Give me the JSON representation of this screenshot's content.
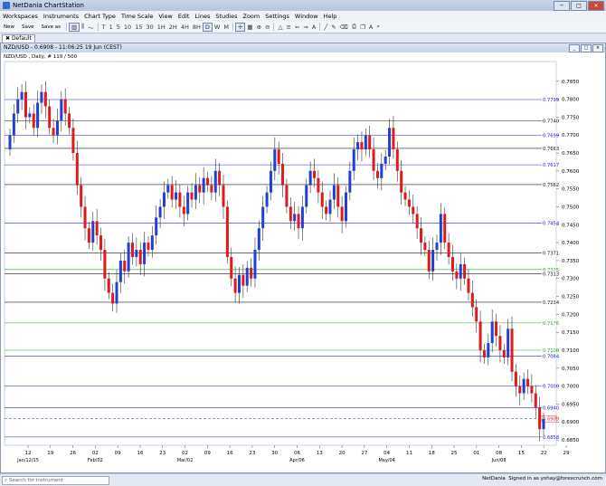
{
  "window": {
    "title": "NetDania ChartStation"
  },
  "menu": [
    "Workspaces",
    "Instruments",
    "Chart Type",
    "Time Scale",
    "View",
    "Edit",
    "Lines",
    "Studies",
    "Zoom",
    "Settings",
    "Window",
    "Help"
  ],
  "toolbar": {
    "file_buttons": [
      "New",
      "Save",
      "Save as"
    ],
    "timescales": [
      "T",
      "1",
      "5",
      "10",
      "15",
      "30",
      "1H",
      "2H",
      "4H",
      "8H",
      "D",
      "W",
      "M"
    ]
  },
  "workspace_tab": {
    "label": "Default"
  },
  "chart": {
    "header_title": "NZD/USD - 0.6908 - 11:06:25 19 Jun (CEST)",
    "subtitle": "NZD/USD , Daily, # 119 / 500",
    "current_price_label": "0.6909"
  },
  "statusbar": {
    "search_placeholder": "Search for instrument",
    "brand": "NetDania",
    "signin": "Signed in as yohay@forexcrunch.com"
  },
  "colors": {
    "up": "#1f3fd6",
    "down": "#e01919",
    "hline": "#1a1a1a",
    "hline_blue": "#2020d0",
    "hline_green": "#22aa22",
    "price": "#6060c0"
  },
  "chart_data": {
    "type": "candlestick",
    "y_ticks": [
      "0.7850",
      "0.7800",
      "0.7750",
      "0.7700",
      "0.7650",
      "0.7600",
      "0.7550",
      "0.7500",
      "0.7450",
      "0.7400",
      "0.7350",
      "0.7300",
      "0.7250",
      "0.7200",
      "0.7150",
      "0.7100",
      "0.7050",
      "0.7000",
      "0.6950",
      "0.6900",
      "0.6850"
    ],
    "ylim": [
      0.6835,
      0.7905
    ],
    "x_ticks": [
      "12",
      "19",
      "26",
      "02",
      "09",
      "16",
      "23",
      "02",
      "09",
      "16",
      "23",
      "30",
      "06",
      "13",
      "20",
      "27",
      "04",
      "11",
      "18",
      "25",
      "01",
      "08",
      "15",
      "22",
      "29"
    ],
    "x_month_labels": [
      {
        "text": "Jan/12/15",
        "at": "12"
      },
      {
        "text": "Feb/02",
        "at": "02"
      },
      {
        "text": "Mar/02",
        "at": "02"
      },
      {
        "text": "Apr/06",
        "at": "06"
      },
      {
        "text": "May/04",
        "at": "04"
      },
      {
        "text": "Jun/08",
        "at": "08"
      }
    ],
    "hlines": [
      {
        "label": "0.7799",
        "value": 0.7799,
        "color": "blue"
      },
      {
        "label": "0.7740",
        "value": 0.774,
        "color": "black"
      },
      {
        "label": "0.7699",
        "value": 0.7699,
        "color": "blue"
      },
      {
        "label": "0.7663",
        "value": 0.7663,
        "color": "black"
      },
      {
        "label": "0.7617",
        "value": 0.7617,
        "color": "blue"
      },
      {
        "label": "0.7562",
        "value": 0.7562,
        "color": "black"
      },
      {
        "label": "0.7454",
        "value": 0.7454,
        "color": "blue"
      },
      {
        "label": "0.7371",
        "value": 0.7371,
        "color": "black"
      },
      {
        "label": "0.7325",
        "value": 0.7325,
        "color": "green"
      },
      {
        "label": "0.7313",
        "value": 0.7313,
        "color": "black"
      },
      {
        "label": "0.7234",
        "value": 0.7234,
        "color": "black"
      },
      {
        "label": "0.7176",
        "value": 0.7176,
        "color": "green"
      },
      {
        "label": "0.7100",
        "value": 0.71,
        "color": "green"
      },
      {
        "label": "0.7084",
        "value": 0.7084,
        "color": "blue"
      },
      {
        "label": "0.7000",
        "value": 0.7,
        "color": "blue"
      },
      {
        "label": "0.6940",
        "value": 0.694,
        "color": "blue"
      },
      {
        "label": "0.6858",
        "value": 0.6858,
        "color": "blue"
      }
    ],
    "current_price": 0.6909,
    "closes": [
      0.77,
      0.776,
      0.78,
      0.782,
      0.775,
      0.776,
      0.772,
      0.779,
      0.782,
      0.778,
      0.772,
      0.77,
      0.774,
      0.78,
      0.776,
      0.772,
      0.765,
      0.756,
      0.75,
      0.744,
      0.74,
      0.746,
      0.742,
      0.738,
      0.73,
      0.726,
      0.723,
      0.729,
      0.735,
      0.732,
      0.74,
      0.736,
      0.738,
      0.734,
      0.74,
      0.738,
      0.742,
      0.747,
      0.75,
      0.754,
      0.756,
      0.752,
      0.754,
      0.75,
      0.748,
      0.754,
      0.752,
      0.756,
      0.754,
      0.758,
      0.756,
      0.754,
      0.76,
      0.756,
      0.75,
      0.736,
      0.73,
      0.726,
      0.731,
      0.728,
      0.733,
      0.73,
      0.738,
      0.744,
      0.75,
      0.754,
      0.76,
      0.766,
      0.762,
      0.756,
      0.75,
      0.746,
      0.748,
      0.744,
      0.75,
      0.756,
      0.76,
      0.758,
      0.754,
      0.75,
      0.748,
      0.752,
      0.756,
      0.75,
      0.746,
      0.754,
      0.76,
      0.766,
      0.768,
      0.766,
      0.77,
      0.766,
      0.76,
      0.758,
      0.762,
      0.764,
      0.772,
      0.766,
      0.76,
      0.754,
      0.752,
      0.75,
      0.748,
      0.744,
      0.74,
      0.738,
      0.732,
      0.738,
      0.74,
      0.748,
      0.74,
      0.736,
      0.732,
      0.73,
      0.734,
      0.73,
      0.726,
      0.722,
      0.718,
      0.71,
      0.708,
      0.712,
      0.718,
      0.714,
      0.71,
      0.708,
      0.716,
      0.704,
      0.7,
      0.698,
      0.702,
      0.7,
      0.698,
      0.694,
      0.688,
      0.6908
    ]
  }
}
